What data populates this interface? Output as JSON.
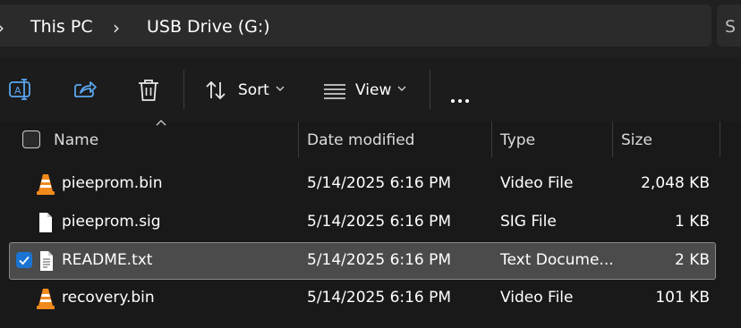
{
  "address": {
    "leading_chevron": "›",
    "crumbs": [
      "This PC",
      "USB Drive (G:)"
    ],
    "separator": "›",
    "search_partial": "S"
  },
  "toolbar": {
    "icons": [
      "rename-icon",
      "share-icon",
      "delete-icon"
    ],
    "sort_label": "Sort",
    "view_label": "View",
    "more_icon": "more-options-icon"
  },
  "columns": {
    "name": "Name",
    "date": "Date modified",
    "type": "Type",
    "size": "Size"
  },
  "files": [
    {
      "name": "pieeprom.bin",
      "date": "5/14/2025 6:16 PM",
      "type": "Video File",
      "size": "2,048 KB",
      "icon": "vlc-icon",
      "selected": false
    },
    {
      "name": "pieeprom.sig",
      "date": "5/14/2025 6:16 PM",
      "type": "SIG File",
      "size": "1 KB",
      "icon": "file-icon",
      "selected": false
    },
    {
      "name": "README.txt",
      "date": "5/14/2025 6:16 PM",
      "type": "Text Docume...",
      "size": "2 KB",
      "icon": "text-file-icon",
      "selected": true
    },
    {
      "name": "recovery.bin",
      "date": "5/14/2025 6:16 PM",
      "type": "Video File",
      "size": "101 KB",
      "icon": "vlc-icon",
      "selected": false
    }
  ],
  "colors": {
    "background": "#191919",
    "selection_fill": "#4b4b4b",
    "checkbox_accent": "#1a74d1",
    "vlc_orange": "#f18a1c"
  }
}
